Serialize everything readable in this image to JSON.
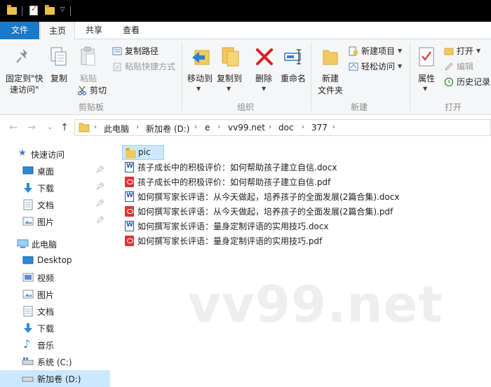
{
  "ribbon": {
    "tabs": {
      "file": "文件",
      "home": "主页",
      "share": "共享",
      "view": "查看"
    },
    "clipboard": {
      "pin_label_1": "固定到\"快",
      "pin_label_2": "速访问\"",
      "copy": "复制",
      "paste": "粘贴",
      "copy_path": "复制路径",
      "paste_shortcut": "粘贴快捷方式",
      "cut": "剪切",
      "group": "剪贴板"
    },
    "organize": {
      "move_to": "移动到",
      "copy_to": "复制到",
      "delete": "删除",
      "rename": "重命名",
      "group": "组织"
    },
    "new": {
      "new_folder_1": "新建",
      "new_folder_2": "文件夹",
      "new_item": "新建项目",
      "easy_access": "轻松访问",
      "group": "新建"
    },
    "open": {
      "properties": "属性",
      "open": "打开",
      "edit": "编辑",
      "history": "历史记录",
      "group": "打开"
    }
  },
  "address": {
    "crumbs": [
      "此电脑",
      "新加卷 (D:)",
      "e",
      "vv99.net",
      "doc",
      "377"
    ]
  },
  "nav": {
    "quick_access": "快速访问",
    "quick_items": [
      {
        "label": "桌面"
      },
      {
        "label": "下载"
      },
      {
        "label": "文档"
      },
      {
        "label": "图片"
      }
    ],
    "this_pc": "此电脑",
    "pc_items": [
      {
        "label": "Desktop"
      },
      {
        "label": "视频"
      },
      {
        "label": "图片"
      },
      {
        "label": "文档"
      },
      {
        "label": "下载"
      },
      {
        "label": "音乐"
      },
      {
        "label": "系统 (C:)"
      },
      {
        "label": "新加卷 (D:)"
      }
    ]
  },
  "files": [
    {
      "name": "pic",
      "type": "folder"
    },
    {
      "name": "孩子成长中的积极评价：如何帮助孩子建立自信.docx",
      "type": "docx"
    },
    {
      "name": "孩子成长中的积极评价：如何帮助孩子建立自信.pdf",
      "type": "pdf"
    },
    {
      "name": "如何撰写家长评语：从今天做起，培养孩子的全面发展(2篇合集).docx",
      "type": "docx"
    },
    {
      "name": "如何撰写家长评语：从今天做起，培养孩子的全面发展(2篇合集).pdf",
      "type": "pdf"
    },
    {
      "name": "如何撰写家长评语：量身定制评语的实用技巧.docx",
      "type": "docx"
    },
    {
      "name": "如何撰写家长评语：量身定制评语的实用技巧.pdf",
      "type": "pdf"
    }
  ],
  "watermark": "vv99.net"
}
